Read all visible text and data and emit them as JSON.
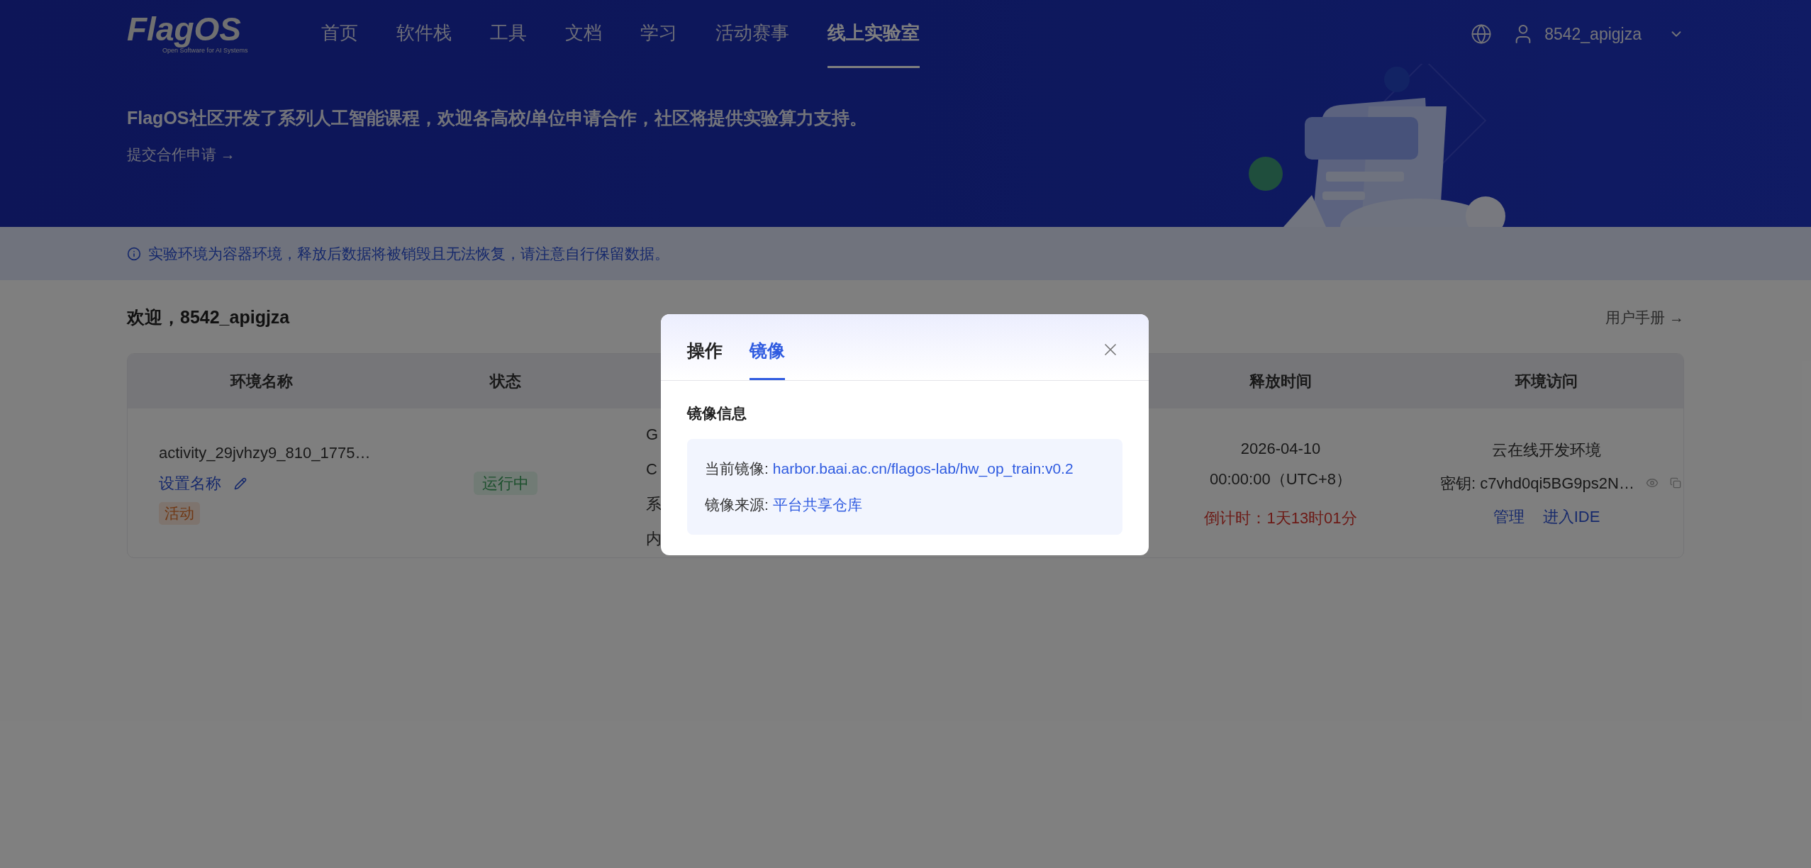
{
  "header": {
    "logo": "FlagOS",
    "logo_tagline": "Open Software for AI Systems",
    "user": "8542_apigjza",
    "nav": [
      {
        "label": "首页",
        "selected": false
      },
      {
        "label": "软件栈",
        "selected": false
      },
      {
        "label": "工具",
        "selected": false
      },
      {
        "label": "文档",
        "selected": false
      },
      {
        "label": "学习",
        "selected": false
      },
      {
        "label": "活动赛事",
        "selected": false
      },
      {
        "label": "线上实验室",
        "selected": true
      }
    ]
  },
  "hero": {
    "headline": "FlagOS社区开发了系列人工智能课程，欢迎各高校/单位申请合作，社区将提供实验算力支持。",
    "link": "提交合作申请 →"
  },
  "notice": "实验环境为容器环境，释放后数据将被销毁且无法恢复，请注意自行保留数据。",
  "welcome": "欢迎，8542_apigjza",
  "manual_link": "用户手册 →",
  "table": {
    "columns": [
      "环境名称",
      "状态",
      "释放时间",
      "环境访问"
    ],
    "rows": [
      {
        "name": "activity_29jvhzy9_810_1775…",
        "rename": "设置名称",
        "tag": "活动",
        "status": "运行中",
        "running": true,
        "specs": [
          "G",
          "C",
          "系",
          "内"
        ],
        "release_date": "2026-04-10",
        "release_time": "00:00:00（UTC+8）",
        "countdown": "倒计时：1天13时01分",
        "access_type": "云在线开发环境",
        "secret": "密钥: c7vhd0qi5BG9ps2N…",
        "actions": [
          "管理",
          "进入IDE"
        ]
      }
    ]
  },
  "modal": {
    "tabs": [
      {
        "label": "操作",
        "selected": false
      },
      {
        "label": "镜像",
        "selected": true
      }
    ],
    "section_title": "镜像信息",
    "fields": [
      {
        "label": "当前镜像:",
        "value": "harbor.baai.ac.cn/flagos-lab/hw_op_train:v0.2"
      },
      {
        "label": "镜像来源:",
        "value": "平台共享仓库"
      }
    ]
  }
}
